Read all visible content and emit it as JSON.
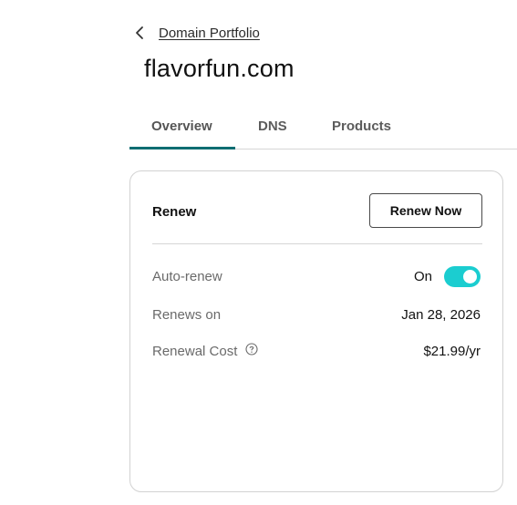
{
  "breadcrumb": {
    "back_icon": "chevron-left-icon",
    "label": "Domain Portfolio"
  },
  "page": {
    "title": "flavorfun.com"
  },
  "tabs": [
    {
      "label": "Overview",
      "active": true
    },
    {
      "label": "DNS",
      "active": false
    },
    {
      "label": "Products",
      "active": false
    }
  ],
  "colors": {
    "accent": "#0b6d72",
    "toggle_on": "#1bcdd0"
  },
  "renew_card": {
    "title": "Renew",
    "renew_button_label": "Renew Now",
    "auto_renew": {
      "label": "Auto-renew",
      "state_label": "On",
      "enabled": true
    },
    "renews_on": {
      "label": "Renews on",
      "value": "Jan 28, 2026"
    },
    "renewal_cost": {
      "label": "Renewal Cost",
      "help_icon": "question-circle-icon",
      "value": "$21.99/yr"
    }
  }
}
